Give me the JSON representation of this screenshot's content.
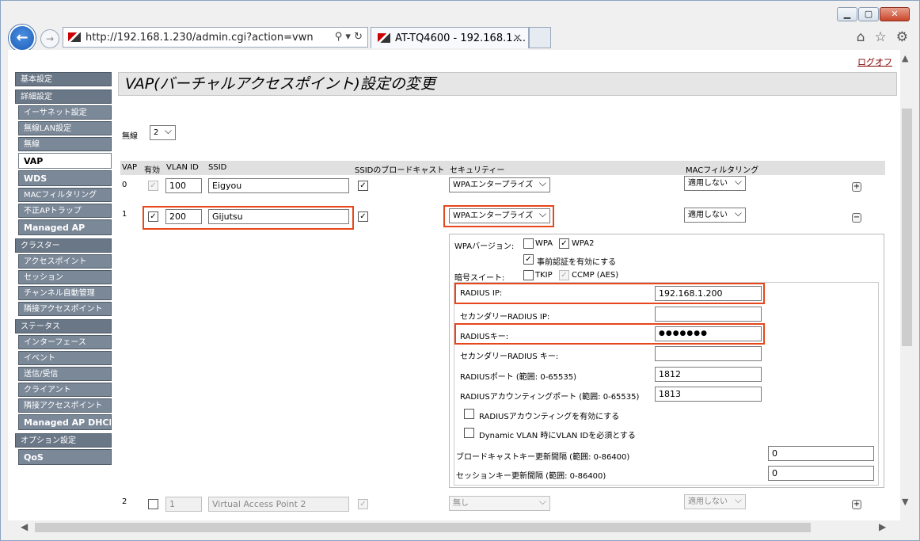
{
  "browser": {
    "url": "http://192.168.1.230/admin.cgi?action=vwn",
    "tab_title": "AT-TQ4600 - 192.168.1....",
    "colors": {
      "accent": "#1d5fb8",
      "highlight": "#e8461b"
    }
  },
  "page": {
    "logoff": "ログオフ",
    "title": "VAP(バーチャルアクセスポイント)設定の変更",
    "radio_label": "無線",
    "radio_value": "2"
  },
  "sidebar": {
    "g1": "基本設定",
    "g2": "詳細設定",
    "i_ether": "イーサネット設定",
    "i_wlan": "無線LAN設定",
    "i_radio": "無線",
    "i_vap": "VAP",
    "i_wds": "WDS",
    "i_mac": "MACフィルタリング",
    "i_rogue": "不正APトラップ",
    "i_managed": "Managed AP",
    "g3": "クラスター",
    "i_ap": "アクセスポイント",
    "i_session": "セッション",
    "i_channel": "チャンネル自動管理",
    "i_neighbor": "隣接アクセスポイント",
    "g4": "ステータス",
    "i_iface": "インターフェース",
    "i_event": "イベント",
    "i_txrx": "送信/受信",
    "i_client": "クライアント",
    "i_neighbor2": "隣接アクセスポイント",
    "i_dhcp": "Managed AP DHCP",
    "g5": "オプション設定",
    "i_qos": "QoS"
  },
  "table": {
    "headers": {
      "vap": "VAP",
      "enabled": "有効",
      "vlan": "VLAN ID",
      "ssid": "SSID",
      "broadcast": "SSIDのブロードキャスト",
      "security": "セキュリティー",
      "mac": "MACフィルタリング"
    },
    "rows": [
      {
        "vap": "0",
        "vlan": "100",
        "ssid": "Eigyou",
        "security": "WPAエンタープライズ",
        "mac": "適用しない",
        "enabled": true,
        "broadcast": true
      },
      {
        "vap": "1",
        "vlan": "200",
        "ssid": "Gijutsu",
        "security": "WPAエンタープライズ",
        "mac": "適用しない",
        "enabled": true,
        "broadcast": true
      },
      {
        "vap": "2",
        "vlan": "1",
        "ssid": "Virtual Access Point 2",
        "security": "無し",
        "mac": "適用しない",
        "enabled": false,
        "broadcast": true
      }
    ]
  },
  "security": {
    "wpa_version_label": "WPAバージョン:",
    "wpa": "WPA",
    "wpa2": "WPA2",
    "preauth": "事前認証を有効にする",
    "cipher_label": "暗号スイート:",
    "tkip": "TKIP",
    "ccmp": "CCMP (AES)",
    "radius_ip_label": "RADIUS IP:",
    "radius_ip": "192.168.1.200",
    "radius_ip2_label": "セカンダリーRADIUS IP:",
    "radius_ip2": "",
    "radius_key_label": "RADIUSキー:",
    "radius_key": "●●●●●●●",
    "radius_key2_label": "セカンダリーRADIUS キー:",
    "radius_key2": "",
    "radius_port_label": "RADIUSポート (範囲: 0-65535)",
    "radius_port": "1812",
    "acct_port_label": "RADIUSアカウンティングポート (範囲: 0-65535)",
    "acct_port": "1813",
    "acct_enable": "RADIUSアカウンティングを有効にする",
    "dyn_vlan": "Dynamic VLAN 時にVLAN IDを必須とする",
    "bcast_key_label": "ブロードキャストキー更新間隔 (範囲: 0-86400)",
    "bcast_key": "0",
    "session_key_label": "セッションキー更新間隔 (範囲: 0-86400)",
    "session_key": "0"
  }
}
